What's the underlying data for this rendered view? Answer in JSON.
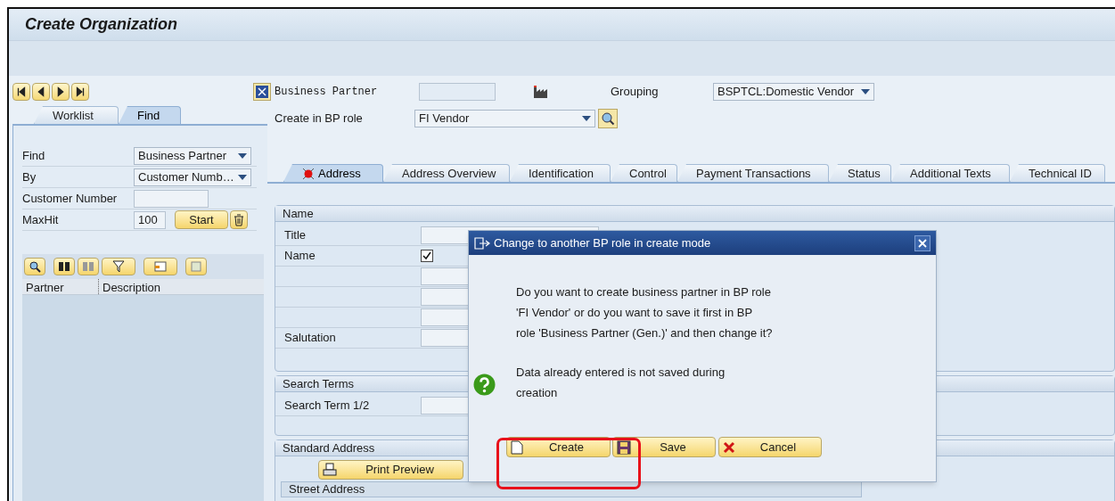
{
  "window": {
    "title": "Create Organization"
  },
  "left_panel": {
    "tabs": [
      {
        "label": "Worklist",
        "selected": false
      },
      {
        "label": "Find",
        "selected": true
      }
    ],
    "find_form": [
      {
        "label": "Find",
        "kind": "dropdown",
        "value": "Business Partner"
      },
      {
        "label": "By",
        "kind": "dropdown",
        "value": "Customer Numb…"
      },
      {
        "label": "Customer Number",
        "kind": "input"
      },
      {
        "label": "MaxHit",
        "kind": "input",
        "value": "100"
      }
    ],
    "start_button": "Start",
    "result_columns": [
      "Partner",
      "Description"
    ]
  },
  "header": {
    "business_partner_label": "Business Partner",
    "grouping_label": "Grouping",
    "grouping_value": "BSPTCL:Domestic Vendor",
    "bp_role_label": "Create in BP role",
    "bp_role_value": "FI Vendor"
  },
  "tabs": [
    {
      "label": "Address",
      "selected": true,
      "flagged": true
    },
    {
      "label": "Address Overview",
      "selected": false,
      "flagged": false
    },
    {
      "label": "Identification",
      "selected": false,
      "flagged": false
    },
    {
      "label": "Control",
      "selected": false,
      "flagged": false
    },
    {
      "label": "Payment Transactions",
      "selected": false,
      "flagged": false
    },
    {
      "label": "Status",
      "selected": false,
      "flagged": false
    },
    {
      "label": "Additional Texts",
      "selected": false,
      "flagged": false
    },
    {
      "label": "Technical ID",
      "selected": false,
      "flagged": false
    }
  ],
  "name_group": {
    "title": "Name",
    "rows": [
      {
        "label": "Title",
        "kind": "input"
      },
      {
        "label": "Name",
        "kind": "checkbox",
        "checked": true
      },
      {
        "kind": "input"
      },
      {
        "kind": "input"
      },
      {
        "kind": "input"
      },
      {
        "label": "Salutation",
        "kind": "input"
      }
    ]
  },
  "search_terms_group": {
    "title": "Search Terms",
    "rows": [
      {
        "label": "Search Term 1/2",
        "kind": "input"
      }
    ]
  },
  "standard_address_group": {
    "title": "Standard Address",
    "print_button": "Print Preview",
    "subsection": "Street Address"
  },
  "dialog": {
    "title": "Change to another BP role in create mode",
    "message": "Do you want to create business partner in BP role 'FI Vendor' or do you want to save it first in BP role 'Business Partner (Gen.)' and then change it?",
    "note": "Data already entered is not saved during creation",
    "buttons": [
      {
        "label": "Create",
        "kind": "create"
      },
      {
        "label": "Save",
        "kind": "save"
      },
      {
        "label": "Cancel",
        "kind": "cancel"
      }
    ]
  }
}
